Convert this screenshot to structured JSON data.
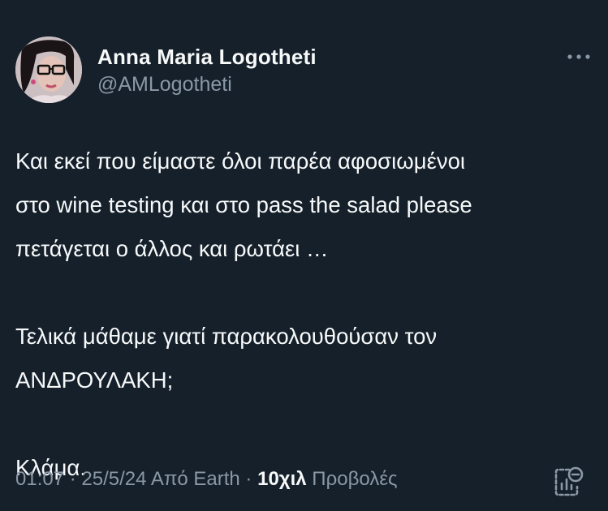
{
  "author": {
    "name": "Anna Maria Logotheti",
    "handle": "@AMLogotheti"
  },
  "icons": {
    "more": "more-horizontal-icon",
    "analytics": "post-analytics-icon"
  },
  "tweet": {
    "lines": [
      "Και εκεί που είμαστε όλοι παρέα αφοσιωμένοι",
      "στο wine testing και στο pass the salad please",
      "πετάγεται ο άλλος  και ρωτάει …",
      "",
      "Τελικά μάθαμε γιατί παρακολουθούσαν τον",
      "ΑΝΔΡΟΥΛΑΚΗ;",
      "",
      "Κλάμα."
    ]
  },
  "meta": {
    "time": "01:07",
    "separator": " · ",
    "date": "25/5/24",
    "source": "Από Earth",
    "views_count": "10χιλ",
    "views_label": "Προβολές"
  },
  "colors": {
    "background": "#15202b",
    "primary_text": "#f7f9f9",
    "secondary_text": "#8b98a5"
  }
}
